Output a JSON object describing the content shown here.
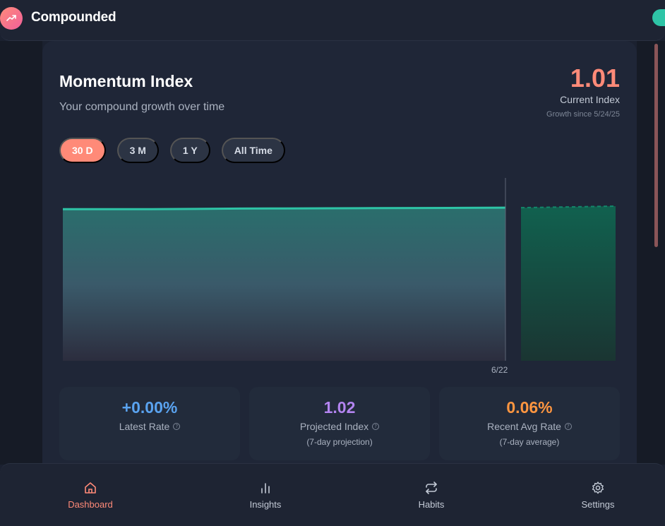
{
  "app": {
    "title": "Compounded"
  },
  "card": {
    "title": "Momentum Index",
    "subtitle": "Your compound growth over time",
    "index_value": "1.01",
    "index_label": "Current Index",
    "index_since": "Growth since 5/24/25"
  },
  "ranges": [
    "30 D",
    "3 M",
    "1 Y",
    "All Time"
  ],
  "active_range": "30 D",
  "chart_data": {
    "type": "area",
    "today_label": "6/22",
    "history": [
      1.0,
      1.0,
      1.0,
      1.002,
      1.004,
      1.005,
      1.006,
      1.007,
      1.008,
      1.009,
      1.01
    ],
    "projection": [
      1.01,
      1.012,
      1.014,
      1.016,
      1.018,
      1.02
    ],
    "colors": {
      "line": "#2ec4a6",
      "projection": "#13866a"
    }
  },
  "stats": [
    {
      "value": "+0.00%",
      "label": "Latest Rate",
      "note": "",
      "color": "#5aa3f0"
    },
    {
      "value": "1.02",
      "label": "Projected Index",
      "note": "(7-day projection)",
      "color": "#b384f0"
    },
    {
      "value": "0.06%",
      "label": "Recent Avg Rate",
      "note": "(7-day average)",
      "color": "#ff9640"
    }
  ],
  "nav": [
    {
      "label": "Dashboard",
      "icon": "home-icon",
      "active": true
    },
    {
      "label": "Insights",
      "icon": "bar-chart-icon",
      "active": false
    },
    {
      "label": "Habits",
      "icon": "repeat-icon",
      "active": false
    },
    {
      "label": "Settings",
      "icon": "gear-icon",
      "active": false
    }
  ]
}
